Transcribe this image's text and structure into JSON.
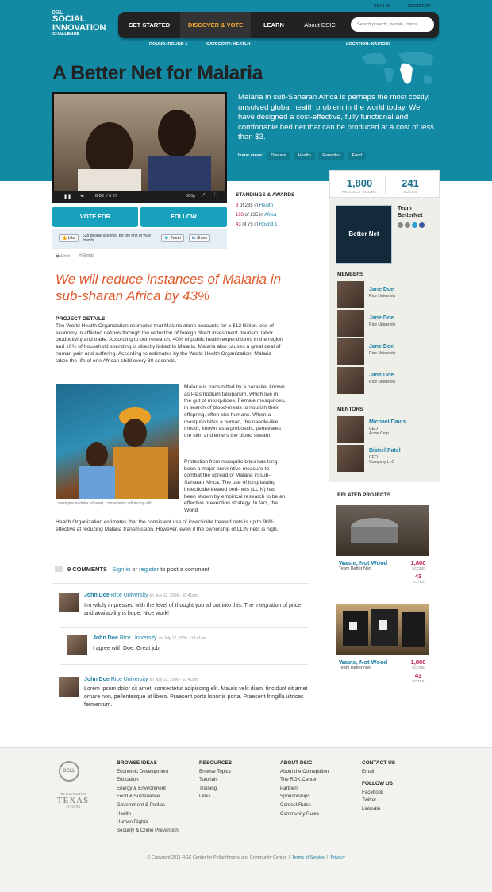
{
  "header": {
    "logo": {
      "brand": "DELL",
      "line1": "SOCIAL",
      "line2": "INNOVATION",
      "line3": "CHALLENGE"
    },
    "sign_in": "SIGN IN",
    "register": "REGISTER",
    "nav": {
      "get_started": "GET STARTED",
      "discover": "DISCOVER & VOTE",
      "learn": "LEARN",
      "about": "About DSIC"
    },
    "search_placeholder": "Search projects, people, topics",
    "meta": {
      "round_label": "ROUND:",
      "round_value": "ROUND 1",
      "category_label": "CATEGORY:",
      "category_value": "HEATLH",
      "location_label": "LOCATION:",
      "location_value": "NAIROBI"
    }
  },
  "project": {
    "title": "A Better Net for Malaria",
    "summary": "Malaria in sub-Saharan Africa is perhaps the most costly, unsolved global health problem in the world today. We have designed a cost-effective, fully functional and comfortable bed net that can be produced at a cost of less than $3.",
    "issue_label": "Issue areas:",
    "issues": [
      "Disease",
      "Health",
      "Parasites",
      "Food"
    ],
    "video": {
      "time": "0:03",
      "duration": "/ 0:37",
      "quality": "360p"
    },
    "vote_label": "VOTE FOR",
    "follow_label": "FOLLOW",
    "social": {
      "like": "Like",
      "like_text": "628 people like this. Be the first of your friends.",
      "tweet": "Tweet",
      "share": "Share"
    },
    "print": "Print",
    "email": "Email",
    "headline": "We will reduce instances of Malaria in sub-sharan Africa by 43%",
    "details_heading": "PROJECT DETAILS",
    "details_p1": "The World Health Organization estimates that Malaria alone accounts for a $12 Billion loss of economy in afflicted nations through the reduction of foreign direct investment, tourism, labor productivity and trade. According to our research, 40% of public health expenditures in the region and 10% of household spending is directly linked to Malaria. Malaria also causes a great deal of human pain and suffering. According to estimates by the World Health Organization, Malaria takes the life of one African child every 30 seconds.",
    "details_p2": "Malaria is transmitted by a parasite, known as Plasmodium falciparum, which live in the gut of mosquitoes. Female mosquitoes, in search of blood-meals to nourish their offspring, often bite humans. When a mosquito bites a human, the needle-like mouth, known as a proboscis, penetrates the skin and enters the blood stream.",
    "details_p3": "Protection from mosquito bites has long been a major preventive measure to combat the spread of Malaria in sub-Saharan Africa. The use of long-lasting insecticide-treated bed-nets (LLIN) has been shown by empirical research to be an effective prevention strategy. In fact, the World",
    "details_p4": "Health Organization estimates that the consistent use of insecticide treated nets is up to 90% effective at reducing Malaria transmission. However, even if the ownership of LLIN nets is high.",
    "photo_caption": "Lorem ipsum dolor sit amet, consectetur adipiscing elit."
  },
  "standings": {
    "heading": "STANDINGS & AWARDS",
    "rows": [
      {
        "rank": "3",
        "of": "of 235 in",
        "where": "Health"
      },
      {
        "rank": "193",
        "of": "of 235 in",
        "where": "Africa"
      },
      {
        "rank": "43",
        "of": "of 75 in",
        "where": "Round 1"
      }
    ]
  },
  "sidebar": {
    "score": "1,800",
    "score_label": "PROJECT SCORE",
    "votes": "241",
    "votes_label": "VOTES",
    "team_line1": "Team",
    "team_line2": "BetterNet",
    "team_image_text": "Better Net",
    "members_heading": "MEMBERS",
    "members": [
      {
        "name": "Jane Doe",
        "org": "Rice University"
      },
      {
        "name": "Jane Doe",
        "org": "Rice University"
      },
      {
        "name": "Jane Doe",
        "org": "Rice University"
      },
      {
        "name": "Jane Doe",
        "org": "Rice University"
      }
    ],
    "mentors_heading": "MENTORS",
    "mentors": [
      {
        "name": "Michael Davis",
        "role": "CEO",
        "org": "Acme Corp"
      },
      {
        "name": "Bishel Patel",
        "role": "CEO",
        "org": "Company LLC"
      }
    ]
  },
  "related": {
    "heading": "RELATED PROJECTS",
    "items": [
      {
        "title": "Waste, Not Wood",
        "team": "Team Better Net",
        "score": "1,800",
        "score_label": "SCORE",
        "votes": "43",
        "votes_label": "VOTES"
      },
      {
        "title": "Waste, Not Wood",
        "team": "Team Better Net",
        "score": "1,800",
        "score_label": "SCORE",
        "votes": "43",
        "votes_label": "VOTES"
      }
    ]
  },
  "comments": {
    "count_label": "9 COMMENTS",
    "sign_in": "Sign in",
    "or": "or",
    "register": "register",
    "to_post": "to post a comment",
    "items": [
      {
        "name": "John Doe",
        "org": "Rice University",
        "date": "on July 12, 2006 - 10:41am",
        "text": "I'm wildly impressed with the level of thought you all put into this. The integration of price and availability is huge. Nice work!"
      },
      {
        "name": "John Doe",
        "org": "Rice University",
        "date": "on July 12, 2006 - 10:41am",
        "text": "I agree with Doe. Great job!"
      },
      {
        "name": "John Doe",
        "org": "Rice University",
        "date": "on July 12, 2006 - 10:41am",
        "text": "Lorem ipsum dolor sit amet, consectetur adipiscing elit. Mauris velit diam, tincidunt sit amet ornare non, pellentesque at libero. Praesent porta lobortis porta. Praesent fringilla ultrices fermentum."
      }
    ]
  },
  "footer": {
    "dell": "DELL",
    "texas_top": "THE UNIVERSITY OF",
    "texas": "TEXAS",
    "texas_bottom": "AT AUSTIN",
    "browse_heading": "BROWSE IDEAS",
    "browse": [
      "Economic Development",
      "Education",
      "Energy & Environment",
      "Food & Sustenance",
      "Government & Politics",
      "Health",
      "Human Rights",
      "Security & Crime Prevention"
    ],
    "resources_heading": "RESOURCES",
    "resources": [
      "Browse Topics",
      "Tutorials",
      "Training",
      "Links"
    ],
    "about_heading": "ABOUT DSIC",
    "about": [
      "About the Comeptition",
      "The RGK Center",
      "Partners",
      "Sponsorships",
      "Contest Rules",
      "Community Rules"
    ],
    "contact_heading": "CONTACT US",
    "contact": [
      "Email"
    ],
    "follow_heading": "FOLLOW US",
    "follow": [
      "Facebook",
      "Twitter",
      "LinkedIn"
    ],
    "copyright": "© Copyright 2011 RGK Center for Philanthrophy and Community Center",
    "terms": "Terms of Service",
    "privacy": "Privacy"
  }
}
